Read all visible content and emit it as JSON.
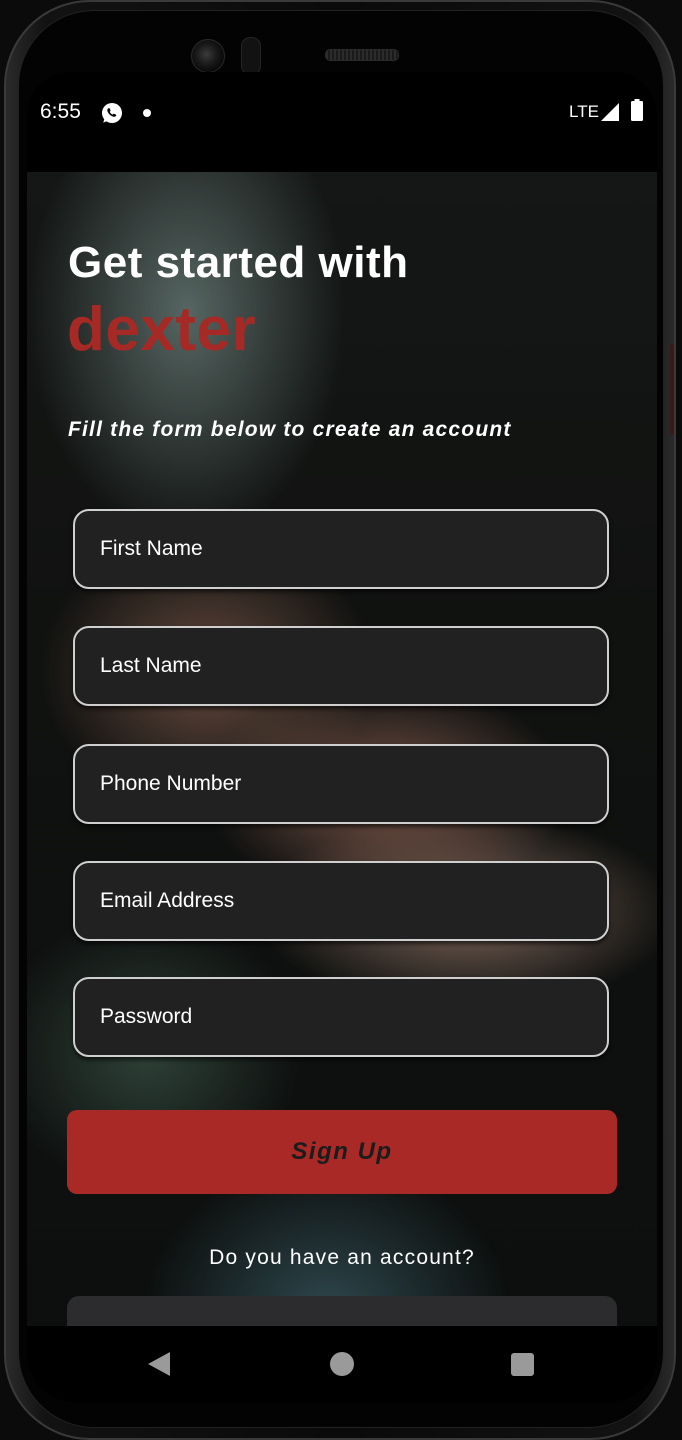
{
  "status_bar": {
    "time": "6:55",
    "network": "LTE",
    "icons": [
      "whatsapp-icon",
      "notification-dot-icon",
      "signal-icon",
      "battery-icon"
    ]
  },
  "header": {
    "title_line": "Get started with",
    "brand": "dexter",
    "subtitle": "Fill the form below to create an account"
  },
  "form": {
    "first_name_placeholder": "First Name",
    "last_name_placeholder": "Last Name",
    "phone_placeholder": "Phone Number",
    "email_placeholder": "Email Address",
    "password_placeholder": "Password",
    "signup_label": "Sign Up",
    "account_question": "Do you have an account?"
  },
  "nav_bar": {
    "icons": [
      "back-icon",
      "home-icon",
      "recents-icon"
    ]
  },
  "colors": {
    "brand_red": "#a52a25",
    "button_red": "#a82925",
    "field_bg": "#212121",
    "field_border": "#cfcfcf"
  }
}
